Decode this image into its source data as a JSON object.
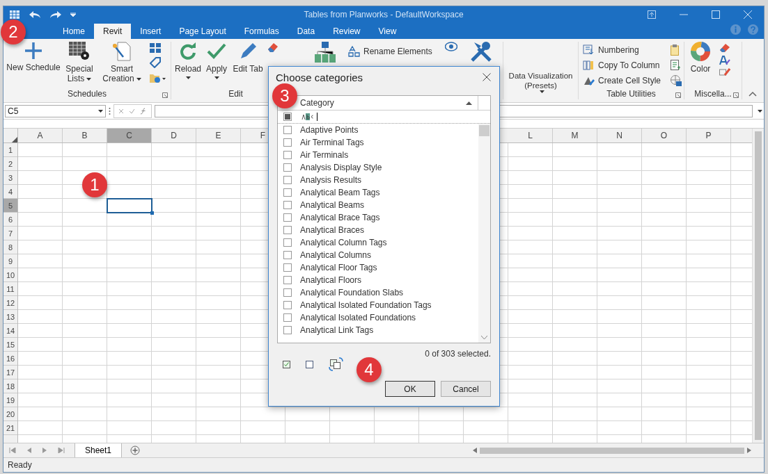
{
  "window": {
    "title": "Tables from Planworks - DefaultWorkspace"
  },
  "tabs": [
    {
      "label": "Home",
      "selected": false
    },
    {
      "label": "Revit",
      "selected": true
    },
    {
      "label": "Insert",
      "selected": false
    },
    {
      "label": "Page Layout",
      "selected": false
    },
    {
      "label": "Formulas",
      "selected": false
    },
    {
      "label": "Data",
      "selected": false
    },
    {
      "label": "Review",
      "selected": false
    },
    {
      "label": "View",
      "selected": false
    }
  ],
  "ribbon": {
    "schedules": {
      "label": "Schedules",
      "buttons": [
        {
          "label": "New Schedule",
          "dropdown": false
        },
        {
          "label": "Special Lists",
          "dropdown": true
        },
        {
          "label": "Smart Creation",
          "dropdown": true
        }
      ]
    },
    "edit": {
      "label": "Edit",
      "buttons": [
        {
          "label": "Reload",
          "dropdown": true
        },
        {
          "label": "Apply",
          "dropdown": true
        },
        {
          "label": "Edit Tab",
          "dropdown": false
        }
      ]
    },
    "elements": {
      "buttons": [
        {
          "label": "Rename Elements"
        }
      ]
    },
    "visualization": {
      "buttons": [
        {
          "label": "Data Visualization (Presets)",
          "dropdown": true
        }
      ]
    },
    "table_utilities": {
      "label": "Table Utilities",
      "buttons": [
        {
          "label": "Numbering"
        },
        {
          "label": "Copy To Column"
        },
        {
          "label": "Create Cell Style"
        }
      ]
    },
    "miscellaneous": {
      "label": "Miscella...",
      "buttons": [
        {
          "label": "Color"
        }
      ]
    }
  },
  "formula_bar": {
    "name_box": "C5"
  },
  "sheet": {
    "columns_left": [
      {
        "label": "A",
        "selected": false
      },
      {
        "label": "B",
        "selected": false
      },
      {
        "label": "C",
        "selected": true
      },
      {
        "label": "D",
        "selected": false
      },
      {
        "label": "E",
        "selected": false
      },
      {
        "label": "F",
        "selected": false
      }
    ],
    "columns_right": [
      {
        "label": "L",
        "selected": false
      },
      {
        "label": "M",
        "selected": false
      },
      {
        "label": "N",
        "selected": false
      },
      {
        "label": "O",
        "selected": false
      },
      {
        "label": "P",
        "selected": false
      }
    ],
    "rows": [
      {
        "label": "1",
        "selected": false
      },
      {
        "label": "2",
        "selected": false
      },
      {
        "label": "3",
        "selected": false
      },
      {
        "label": "4",
        "selected": false
      },
      {
        "label": "5",
        "selected": true
      },
      {
        "label": "6",
        "selected": false
      },
      {
        "label": "7",
        "selected": false
      },
      {
        "label": "8",
        "selected": false
      },
      {
        "label": "9",
        "selected": false
      },
      {
        "label": "10",
        "selected": false
      },
      {
        "label": "11",
        "selected": false
      },
      {
        "label": "12",
        "selected": false
      },
      {
        "label": "13",
        "selected": false
      },
      {
        "label": "14",
        "selected": false
      },
      {
        "label": "15",
        "selected": false
      },
      {
        "label": "16",
        "selected": false
      },
      {
        "label": "17",
        "selected": false
      },
      {
        "label": "18",
        "selected": false
      },
      {
        "label": "19",
        "selected": false
      },
      {
        "label": "20",
        "selected": false
      },
      {
        "label": "21",
        "selected": false
      }
    ]
  },
  "sheet_tabs": [
    {
      "label": "Sheet1",
      "selected": true
    }
  ],
  "status_bar": "Ready",
  "dialog": {
    "title": "Choose categories",
    "column": "Category",
    "select_all": {
      "indeterminate": true
    },
    "items": [
      {
        "label": "Adaptive Points",
        "checked": false
      },
      {
        "label": "Air Terminal Tags",
        "checked": false
      },
      {
        "label": "Air Terminals",
        "checked": false
      },
      {
        "label": "Analysis Display Style",
        "checked": false
      },
      {
        "label": "Analysis Results",
        "checked": false
      },
      {
        "label": "Analytical Beam Tags",
        "checked": false
      },
      {
        "label": "Analytical Beams",
        "checked": false
      },
      {
        "label": "Analytical Brace Tags",
        "checked": false
      },
      {
        "label": "Analytical Braces",
        "checked": false
      },
      {
        "label": "Analytical Column Tags",
        "checked": false
      },
      {
        "label": "Analytical Columns",
        "checked": false
      },
      {
        "label": "Analytical Floor Tags",
        "checked": false
      },
      {
        "label": "Analytical Floors",
        "checked": false
      },
      {
        "label": "Analytical Foundation Slabs",
        "checked": false
      },
      {
        "label": "Analytical Isolated Foundation Tags",
        "checked": false
      },
      {
        "label": "Analytical Isolated Foundations",
        "checked": false
      },
      {
        "label": "Analytical Link Tags",
        "checked": false
      }
    ],
    "summary": "0 of 303 selected.",
    "buttons": [
      "OK",
      "Cancel"
    ]
  },
  "callouts": [
    "1",
    "2",
    "3",
    "4"
  ]
}
